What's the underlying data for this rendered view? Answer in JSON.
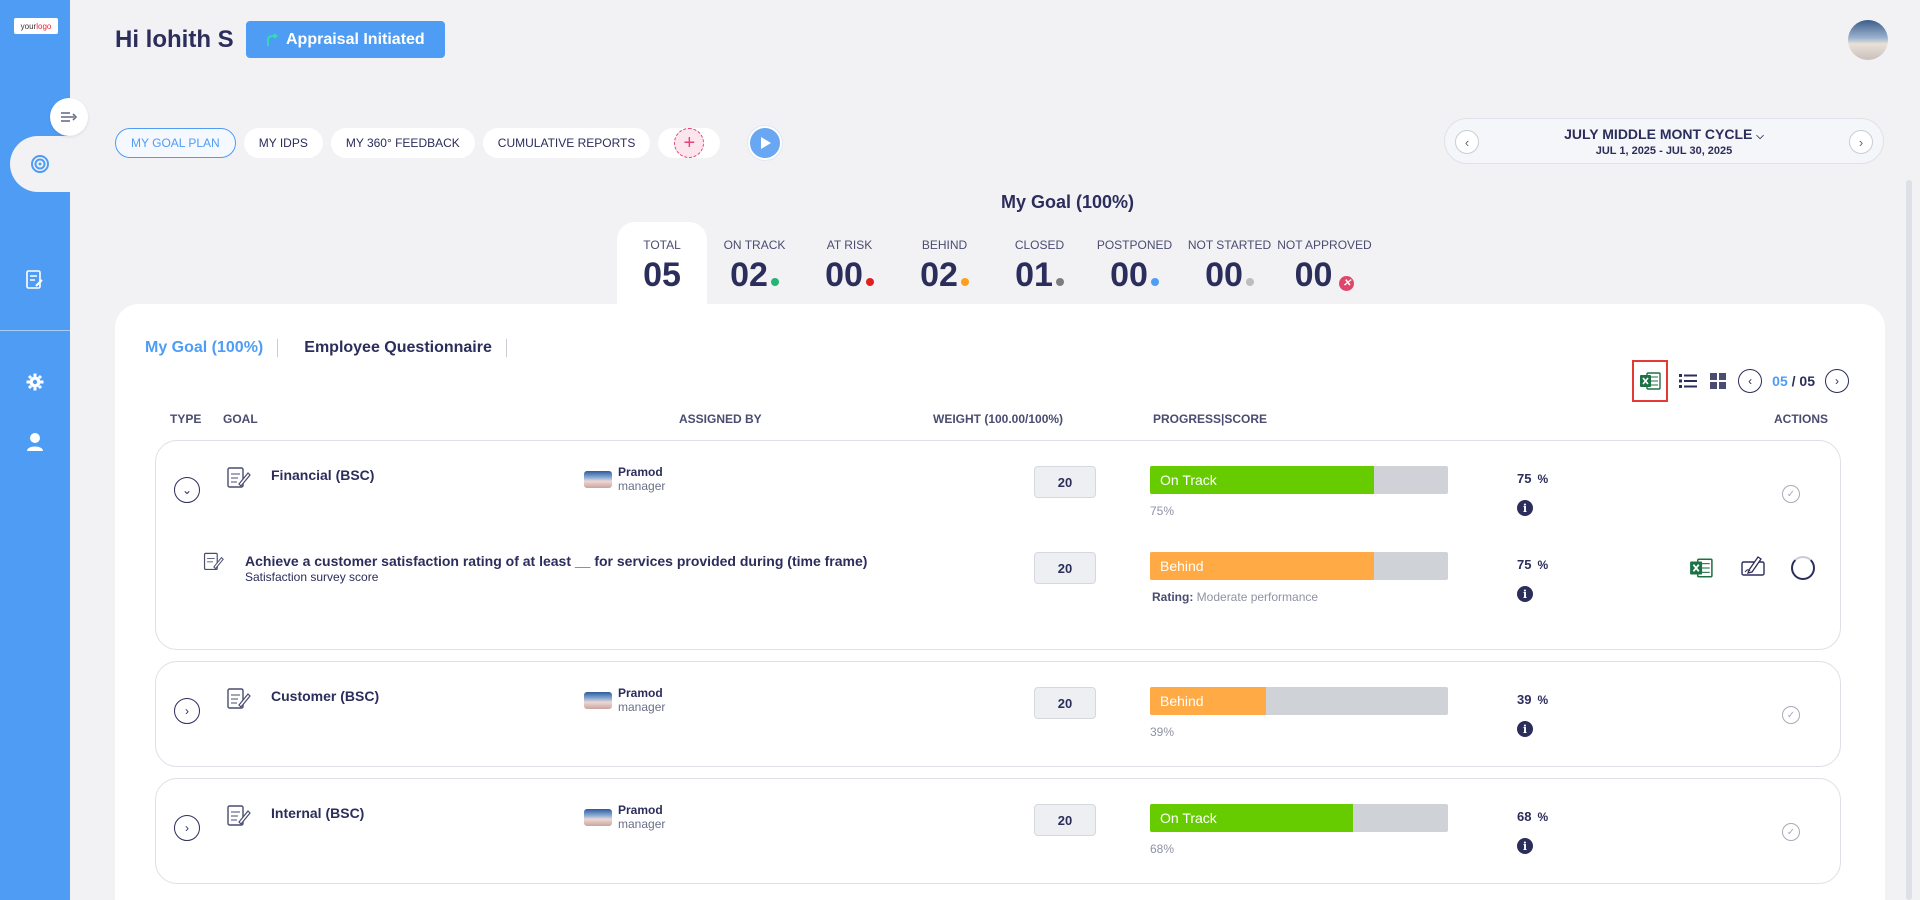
{
  "sidebar": {
    "logo_text_a": "your",
    "logo_text_b": "logo"
  },
  "header": {
    "greeting": "Hi lohith S",
    "badge": "Appraisal Initiated"
  },
  "tabs": [
    "MY GOAL PLAN",
    "MY IDPS",
    "MY 360° FEEDBACK",
    "CUMULATIVE REPORTS"
  ],
  "cycle": {
    "title": "JULY MIDDLE MONT CYCLE",
    "dates": "JUL 1, 2025 - JUL 30, 2025"
  },
  "goal_heading": "My Goal (100%)",
  "stats": [
    {
      "label": "TOTAL",
      "value": "05"
    },
    {
      "label": "ON TRACK",
      "value": "02",
      "color": "#22b573"
    },
    {
      "label": "AT RISK",
      "value": "00",
      "color": "#e02020"
    },
    {
      "label": "BEHIND",
      "value": "02",
      "color": "#ff9f1c"
    },
    {
      "label": "CLOSED",
      "value": "01",
      "color": "#7d7d7d"
    },
    {
      "label": "POSTPONED",
      "value": "00",
      "color": "#4f9cf5"
    },
    {
      "label": "NOT STARTED",
      "value": "00",
      "color": "#bdbdbd"
    },
    {
      "label": "NOT APPROVED",
      "value": "00"
    }
  ],
  "sub_tabs": [
    "My Goal (100%)",
    "Employee Questionnaire"
  ],
  "pager": {
    "current": "05",
    "total": "05",
    "sep": "/"
  },
  "table": {
    "headers": {
      "type": "TYPE",
      "goal": "GOAL",
      "assigned": "ASSIGNED BY",
      "weight": "WEIGHT (100.00/100%)",
      "progress": "PROGRESS|SCORE",
      "actions": "ACTIONS"
    }
  },
  "goals": [
    {
      "title": "Financial (BSC)",
      "assigner": "Pramod",
      "role": "manager",
      "weight": "20",
      "status": "On Track",
      "progress": 75,
      "caption": "75%",
      "score": "75",
      "pct": "%",
      "sub": {
        "title": "Achieve a customer satisfaction rating of at least __ for services provided during (time frame)",
        "desc": "Satisfaction survey score",
        "weight": "20",
        "status": "Behind",
        "progress": 75,
        "rating_label": "Rating:",
        "rating_value": "Moderate performance",
        "score": "75",
        "pct": "%"
      }
    },
    {
      "title": "Customer (BSC)",
      "assigner": "Pramod",
      "role": "manager",
      "weight": "20",
      "status": "Behind",
      "progress": 39,
      "caption": "39%",
      "score": "39",
      "pct": "%"
    },
    {
      "title": "Internal (BSC)",
      "assigner": "Pramod",
      "role": "manager",
      "weight": "20",
      "status": "On Track",
      "progress": 68,
      "caption": "68%",
      "score": "68",
      "pct": "%"
    }
  ]
}
